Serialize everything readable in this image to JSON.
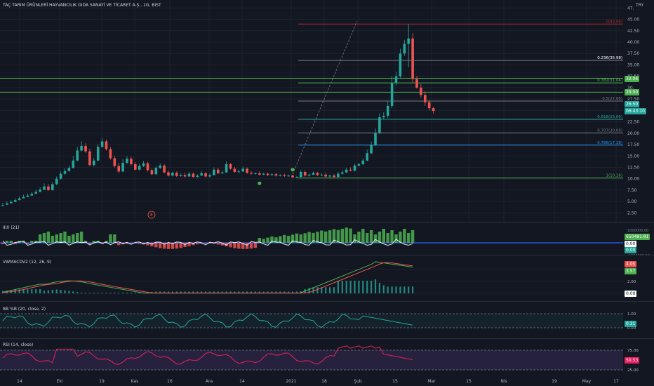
{
  "header": {
    "symbol_title": "TAÇ TARIM ÜRÜNLERİ HAYVANCILIK GIDA SANAYİ VE TİCARET A.Ş., 1G, BIST",
    "currency": "TRY"
  },
  "colors": {
    "background": "#131722",
    "grid": "#1e222d",
    "up": "#26a69a",
    "down": "#ef5350",
    "text": "#d1d4dc",
    "fib_red": "#b22833",
    "fib_gray": "#787b86",
    "fib_green": "#4caf50",
    "fib_teal": "#26a69a",
    "fib_blue": "#2196f3",
    "hline_green": "#4caf50",
    "macd_line": "#4caf50",
    "signal_line": "#ef5350",
    "rsi_line": "#e91e63",
    "rsi_band": "#7e57c2",
    "bb_line": "#26a69a"
  },
  "main_chart": {
    "price_axis_ticks": [
      "47.",
      "45.00",
      "42.50",
      "40.00",
      "37.50",
      "35.00",
      "32.50",
      "30.",
      "27.50",
      "25.",
      "22.50",
      "20.00",
      "17.50",
      "15.00",
      "12.50",
      "10.00",
      "7.50",
      "5.00",
      "2.50"
    ],
    "fib_levels": [
      {
        "label": "0(43.96)",
        "price": 43.96,
        "color": "#b22833"
      },
      {
        "label": "0.236(35.98)",
        "price": 35.98,
        "color": "#787b86"
      },
      {
        "label": "0.382(31.04)",
        "price": 31.04,
        "color": "#4caf50"
      },
      {
        "label": "0.5(27.06)",
        "price": 27.06,
        "color": "#787b86"
      },
      {
        "label": "0.618(23.06)",
        "price": 23.06,
        "color": "#26a69a"
      },
      {
        "label": "0.707(20.06)",
        "price": 20.06,
        "color": "#787b86"
      },
      {
        "label": "0.786(17.38)",
        "price": 17.38,
        "color": "#2196f3"
      },
      {
        "label": "1(10.16)",
        "price": 10.16,
        "color": "#4caf50"
      }
    ],
    "horizontal_lines": [
      32.06,
      29.0
    ],
    "price_tags": [
      {
        "text": "32.06",
        "price": 32.06,
        "bg": "#4caf50",
        "fg": "#ffffff"
      },
      {
        "text": "29.00",
        "price": 29.0,
        "bg": "#4caf50",
        "fg": "#ffffff"
      },
      {
        "text": "26.50",
        "price": 26.5,
        "bg": "#26a69a",
        "fg": "#ffffff"
      },
      {
        "text": "06:43:10",
        "price": 24.9,
        "bg": "#26a69a",
        "fg": "#ffffff"
      }
    ],
    "earnings_marker": "E",
    "candles": [
      [
        4,
        4.6,
        4.2,
        4.7,
        4.1
      ],
      [
        4.3,
        4.9,
        4.6,
        5.0,
        4.4
      ],
      [
        4.6,
        5.2,
        4.9,
        5.3,
        4.7
      ],
      [
        4.9,
        5.6,
        5.3,
        5.7,
        5.1
      ],
      [
        5.3,
        6.0,
        5.7,
        6.1,
        5.5
      ],
      [
        5.7,
        6.3,
        6.0,
        6.5,
        5.8
      ],
      [
        6.0,
        6.6,
        6.3,
        6.8,
        6.1
      ],
      [
        6.3,
        7.0,
        6.7,
        7.1,
        6.5
      ],
      [
        6.7,
        7.5,
        7.1,
        7.6,
        6.8
      ],
      [
        7.1,
        8.0,
        7.6,
        8.1,
        7.2
      ],
      [
        7.6,
        8.7,
        8.3,
        9.0,
        7.5
      ],
      [
        8.3,
        8.6,
        7.5,
        8.9,
        7.3
      ],
      [
        7.5,
        9.0,
        8.8,
        9.3,
        7.4
      ],
      [
        8.8,
        10.3,
        10.0,
        10.5,
        8.6
      ],
      [
        10.0,
        11.3,
        11.1,
        11.6,
        9.8
      ],
      [
        11.1,
        12.0,
        11.7,
        12.3,
        10.9
      ],
      [
        11.7,
        12.6,
        12.4,
        12.9,
        11.5
      ],
      [
        12.4,
        14.5,
        14.0,
        15.0,
        12.2
      ],
      [
        14.0,
        16.5,
        16.2,
        17.0,
        13.8
      ],
      [
        16.2,
        17.8,
        17.2,
        18.2,
        15.9
      ],
      [
        17.2,
        17.5,
        16.0,
        17.8,
        15.7
      ],
      [
        16.0,
        16.3,
        13.0,
        16.6,
        12.8
      ],
      [
        13.0,
        14.2,
        14.0,
        14.6,
        12.7
      ],
      [
        14.0,
        17.3,
        17.0,
        17.6,
        13.8
      ],
      [
        17.0,
        18.5,
        18.2,
        19.0,
        16.8
      ],
      [
        18.2,
        18.4,
        16.5,
        18.6,
        16.2
      ],
      [
        16.5,
        16.8,
        14.5,
        17.0,
        14.2
      ],
      [
        14.5,
        14.8,
        12.8,
        15.0,
        12.5
      ],
      [
        12.8,
        13.2,
        11.6,
        13.5,
        11.3
      ],
      [
        11.6,
        14.0,
        13.5,
        14.3,
        11.4
      ],
      [
        13.5,
        14.8,
        14.4,
        15.0,
        13.2
      ],
      [
        14.4,
        14.6,
        13.2,
        14.8,
        12.9
      ],
      [
        13.2,
        13.4,
        12.0,
        13.6,
        11.8
      ],
      [
        12.0,
        13.0,
        12.8,
        13.2,
        11.8
      ],
      [
        12.8,
        13.6,
        13.4,
        13.9,
        12.6
      ],
      [
        13.4,
        13.5,
        11.9,
        13.7,
        11.6
      ],
      [
        11.9,
        12.1,
        11.0,
        12.3,
        10.8
      ],
      [
        11.0,
        12.6,
        12.4,
        12.8,
        10.9
      ],
      [
        12.4,
        13.2,
        12.9,
        13.4,
        12.1
      ],
      [
        12.9,
        13.0,
        11.4,
        13.2,
        11.2
      ],
      [
        11.4,
        11.7,
        10.7,
        11.8,
        10.5
      ],
      [
        10.7,
        11.5,
        11.3,
        11.6,
        10.5
      ],
      [
        11.3,
        11.4,
        10.6,
        11.6,
        10.4
      ],
      [
        10.6,
        11.0,
        10.8,
        11.2,
        10.4
      ],
      [
        10.8,
        11.1,
        10.5,
        11.3,
        10.3
      ],
      [
        10.5,
        11.4,
        11.1,
        11.5,
        10.4
      ],
      [
        11.1,
        11.2,
        10.4,
        11.4,
        10.2
      ],
      [
        10.4,
        10.9,
        10.7,
        11.0,
        10.2
      ],
      [
        10.7,
        11.5,
        11.2,
        11.7,
        10.6
      ],
      [
        11.2,
        11.3,
        10.5,
        11.5,
        10.3
      ],
      [
        10.5,
        11.0,
        10.8,
        11.1,
        10.3
      ],
      [
        10.8,
        12.3,
        12.0,
        12.5,
        10.7
      ],
      [
        12.0,
        12.2,
        11.2,
        12.4,
        11.0
      ],
      [
        11.2,
        11.6,
        11.4,
        11.8,
        11.0
      ],
      [
        11.4,
        13.5,
        13.2,
        13.8,
        11.3
      ],
      [
        13.2,
        13.3,
        12.2,
        13.5,
        12.0
      ],
      [
        12.2,
        12.4,
        11.5,
        12.6,
        11.3
      ],
      [
        11.5,
        11.8,
        11.6,
        12.0,
        11.3
      ],
      [
        11.6,
        12.5,
        12.2,
        12.7,
        11.5
      ],
      [
        12.2,
        12.3,
        11.3,
        12.5,
        11.1
      ],
      [
        11.3,
        11.5,
        11.1,
        11.7,
        10.9
      ],
      [
        11.1,
        11.3,
        11.2,
        11.4,
        10.9
      ],
      [
        11.2,
        11.4,
        10.9,
        11.6,
        10.7
      ],
      [
        10.9,
        11.2,
        11.1,
        11.3,
        10.8
      ],
      [
        11.1,
        11.3,
        10.8,
        11.4,
        10.6
      ],
      [
        10.8,
        11.1,
        11.0,
        11.2,
        10.7
      ],
      [
        11.0,
        11.1,
        10.7,
        11.3,
        10.5
      ],
      [
        10.7,
        10.9,
        10.8,
        11.0,
        10.5
      ],
      [
        10.8,
        11.0,
        10.6,
        11.1,
        10.4
      ],
      [
        10.6,
        10.8,
        10.7,
        10.9,
        10.4
      ],
      [
        10.7,
        10.8,
        10.3,
        10.9,
        10.1
      ],
      [
        10.3,
        10.5,
        10.4,
        10.6,
        10.1
      ],
      [
        10.4,
        11.7,
        11.5,
        11.9,
        10.3
      ],
      [
        11.5,
        11.6,
        10.7,
        11.8,
        10.5
      ],
      [
        10.7,
        11.0,
        10.9,
        11.1,
        10.5
      ],
      [
        10.9,
        11.5,
        11.3,
        11.6,
        10.8
      ],
      [
        11.3,
        11.4,
        10.8,
        11.5,
        10.6
      ],
      [
        10.8,
        11.0,
        10.9,
        11.2,
        10.6
      ],
      [
        10.9,
        11.2,
        10.5,
        11.3,
        10.3
      ],
      [
        10.5,
        10.8,
        10.7,
        10.9,
        10.3
      ],
      [
        10.7,
        10.9,
        10.4,
        11.0,
        10.2
      ],
      [
        10.4,
        11.3,
        11.1,
        11.5,
        10.3
      ],
      [
        11.1,
        11.6,
        11.4,
        11.8,
        10.9
      ],
      [
        11.4,
        12.2,
        12.0,
        12.4,
        11.2
      ],
      [
        12.0,
        12.3,
        11.8,
        12.5,
        11.6
      ],
      [
        11.8,
        13.1,
        12.9,
        13.3,
        11.6
      ],
      [
        12.9,
        13.3,
        13.2,
        13.5,
        12.7
      ],
      [
        13.2,
        14.2,
        14.0,
        14.5,
        13.0
      ],
      [
        14.0,
        16.0,
        15.6,
        16.4,
        13.8
      ],
      [
        15.6,
        17.8,
        17.4,
        18.2,
        15.4
      ],
      [
        17.4,
        20.6,
        20.1,
        21.0,
        17.2
      ],
      [
        20.1,
        24.0,
        23.5,
        24.4,
        19.8
      ],
      [
        23.5,
        24.2,
        23.8,
        24.6,
        23.0
      ],
      [
        23.8,
        26.5,
        26.0,
        27.0,
        23.4
      ],
      [
        26.0,
        31.8,
        31.0,
        32.5,
        25.5
      ],
      [
        31.0,
        33.0,
        32.5,
        33.5,
        30.5
      ],
      [
        32.5,
        38.0,
        37.5,
        38.5,
        32.0
      ],
      [
        37.5,
        40.0,
        39.6,
        40.5,
        37.0
      ],
      [
        39.6,
        44.0,
        40.8,
        44.0,
        34.5
      ],
      [
        40.8,
        41.5,
        31.9,
        42.0,
        31.0
      ],
      [
        31.9,
        32.2,
        30.0,
        32.6,
        29.8
      ],
      [
        30.0,
        30.5,
        28.4,
        30.8,
        27.8
      ],
      [
        28.4,
        29.0,
        26.8,
        29.2,
        26.0
      ],
      [
        26.8,
        27.0,
        25.5,
        27.3,
        25.0
      ],
      [
        25.5,
        25.6,
        24.9,
        25.8,
        24.3
      ]
    ],
    "markers": [
      {
        "index": 62,
        "price": 9.0,
        "color": "#4caf50"
      },
      {
        "index": 70,
        "price": 12.0,
        "color": "#4caf50"
      }
    ],
    "dashed_projection": [
      [
        70,
        11.0
      ],
      [
        83,
        44.6
      ]
    ]
  },
  "iiix": {
    "title": "IIIX (21)",
    "ticks": [
      "1000000.00",
      "0.00",
      "-1000000.00"
    ],
    "tags": [
      {
        "text": "650481.81",
        "bg": "#4caf50",
        "fg": "#ffffff"
      },
      {
        "text": "0.00",
        "bg": "#ffffff",
        "fg": "#131722"
      },
      {
        "text": "0.00",
        "bg": "#26a69a",
        "fg": "#ffffff"
      }
    ]
  },
  "vwmacd": {
    "title": "VWMACDV2 (12, 26, 9)",
    "ticks": [
      "4.00",
      "2.00",
      "0.00"
    ],
    "tags": [
      {
        "text": "4.05",
        "bg": "#ef5350",
        "fg": "#ffffff"
      },
      {
        "text": "3.57",
        "bg": "#4caf50",
        "fg": "#ffffff"
      },
      {
        "text": "0.00",
        "bg": "#ffffff",
        "fg": "#131722"
      }
    ]
  },
  "bb": {
    "title": "BB %B (20, close, 2)",
    "ticks": [
      "1.00",
      "0.00"
    ],
    "tag": {
      "text": "0.31",
      "bg": "#26a69a",
      "fg": "#ffffff"
    }
  },
  "rsi": {
    "title": "RSI (14, close)",
    "ticks": [
      "75.00",
      "25.00"
    ],
    "tag": {
      "text": "50.53",
      "bg": "#e91e63",
      "fg": "#ffffff"
    }
  },
  "time_axis": {
    "labels": [
      "14",
      "Eki",
      "19",
      "Kas",
      "16",
      "Ara",
      "14",
      "2021",
      "18",
      "Şub",
      "15",
      "Mar",
      "15",
      "Nis",
      "19",
      "May",
      "17"
    ]
  }
}
